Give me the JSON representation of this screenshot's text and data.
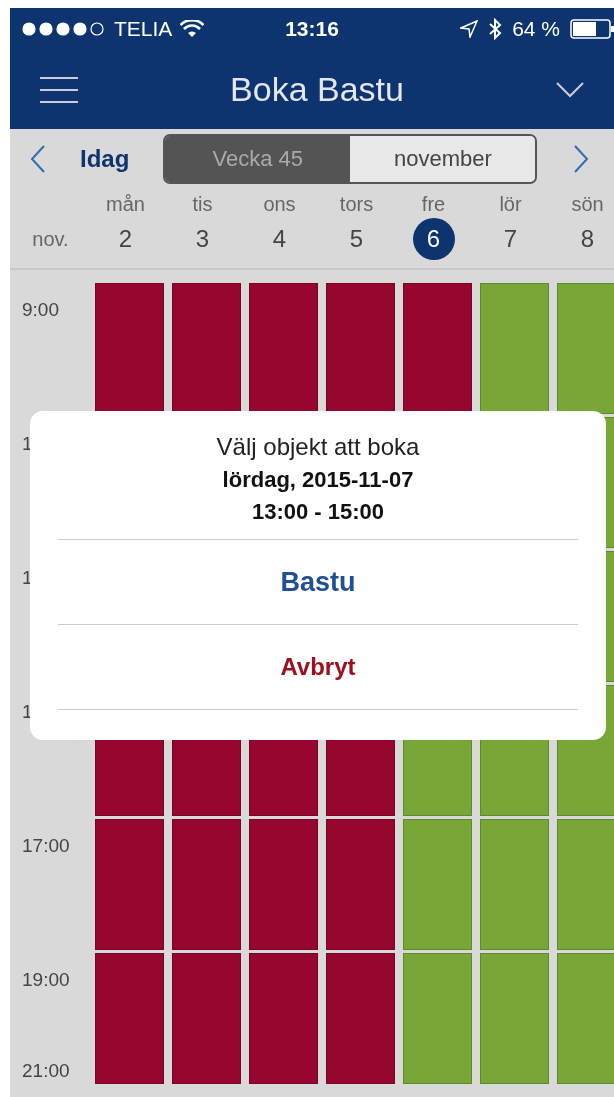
{
  "status_bar": {
    "carrier": "TELIA",
    "time": "13:16",
    "battery": "64 %"
  },
  "nav_bar": {
    "title": "Boka Bastu"
  },
  "toolbar": {
    "today": "Idag",
    "segments": [
      {
        "label": "Vecka 45",
        "selected": true
      },
      {
        "label": "november",
        "selected": false
      }
    ]
  },
  "week": {
    "month": "nov.",
    "days": [
      {
        "name": "mån",
        "date": "2",
        "selected": false
      },
      {
        "name": "tis",
        "date": "3",
        "selected": false
      },
      {
        "name": "ons",
        "date": "4",
        "selected": false
      },
      {
        "name": "tors",
        "date": "5",
        "selected": false
      },
      {
        "name": "fre",
        "date": "6",
        "selected": true
      },
      {
        "name": "lör",
        "date": "7",
        "selected": false
      },
      {
        "name": "sön",
        "date": "8",
        "selected": false
      }
    ]
  },
  "schedule": {
    "rows": [
      {
        "time": "9:00",
        "cells": [
          {
            "booked": true
          },
          {
            "booked": true
          },
          {
            "booked": true
          },
          {
            "booked": true
          },
          {
            "booked": true
          },
          {
            "booked": false
          },
          {
            "booked": false
          }
        ]
      },
      {
        "time": "1",
        "cells": [
          {
            "booked": false
          }
        ]
      },
      {
        "time": "1",
        "cells": [
          {
            "booked": false
          }
        ]
      },
      {
        "time": "1",
        "cells": [
          {
            "booked": true
          },
          {
            "booked": true
          },
          {
            "booked": true
          },
          {
            "booked": true
          },
          {
            "booked": false
          },
          {
            "booked": false
          },
          {
            "booked": false
          }
        ]
      },
      {
        "time": "17:00",
        "cells": [
          {
            "booked": true
          },
          {
            "booked": true
          },
          {
            "booked": true
          },
          {
            "booked": true
          },
          {
            "booked": false
          },
          {
            "booked": false
          },
          {
            "booked": false
          }
        ]
      },
      {
        "time": "19:00",
        "cells": [
          {
            "booked": true
          },
          {
            "booked": true
          },
          {
            "booked": true
          },
          {
            "booked": true
          },
          {
            "booked": false
          },
          {
            "booked": false
          },
          {
            "booked": false
          }
        ]
      }
    ],
    "trailing_time": "21:00"
  },
  "dialog": {
    "title": "Välj objekt att boka",
    "date": "lördag, 2015-11-07",
    "time": "13:00 - 15:00",
    "actions": [
      {
        "label": "Bastu",
        "kind": "confirm"
      },
      {
        "label": "Avbryt",
        "kind": "cancel"
      }
    ]
  }
}
